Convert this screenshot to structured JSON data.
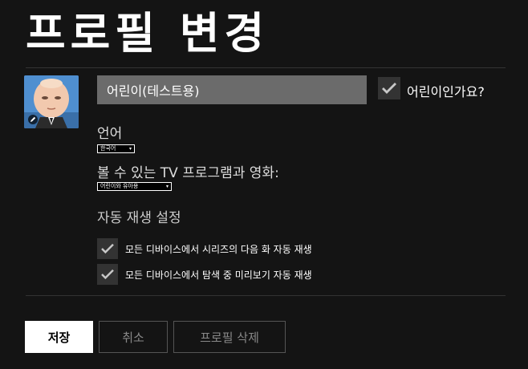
{
  "page": {
    "title": "프로필 변경"
  },
  "profile": {
    "name_value": "어린이(테스트용)",
    "kids_label": "어린이인가요?",
    "kids_checked": true,
    "avatar_edit_icon": "pencil-icon"
  },
  "language": {
    "label": "언어",
    "selected": "한국어"
  },
  "maturity": {
    "label": "볼 수 있는 TV 프로그램과 영화:",
    "selected": "어린이와 유아용"
  },
  "autoplay": {
    "title": "자동 재생 설정",
    "options": [
      {
        "label": "모든 디바이스에서 시리즈의 다음 화 자동 재생",
        "checked": true
      },
      {
        "label": "모든 디바이스에서 탐색 중 미리보기 자동 재생",
        "checked": true
      }
    ]
  },
  "actions": {
    "save": "저장",
    "cancel": "취소",
    "delete": "프로필 삭제"
  },
  "colors": {
    "background": "#141414",
    "input_bg": "#6b6b6b",
    "checkbox_bg": "#333333",
    "save_bg": "#ffffff",
    "secondary_text": "#888888"
  }
}
